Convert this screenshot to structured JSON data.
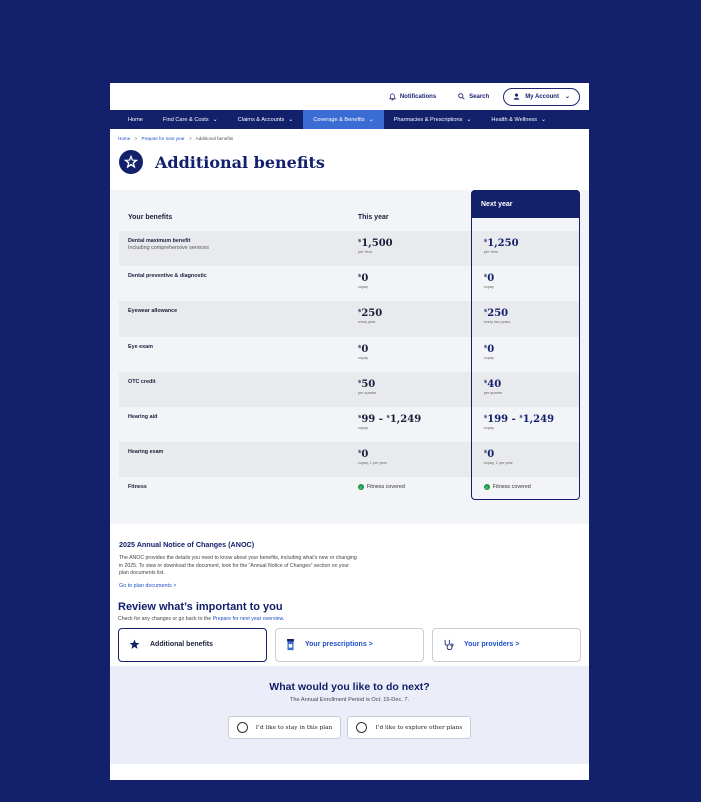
{
  "topbar": {
    "notifications": "Notifications",
    "search": "Search",
    "account": "My Account"
  },
  "nav": [
    {
      "label": "Home",
      "dropdown": false,
      "active": false
    },
    {
      "label": "Find Care & Costs",
      "dropdown": true,
      "active": false
    },
    {
      "label": "Claims & Accounts",
      "dropdown": true,
      "active": false
    },
    {
      "label": "Coverage & Benefits",
      "dropdown": true,
      "active": true
    },
    {
      "label": "Pharmacies & Prescriptions",
      "dropdown": true,
      "active": false
    },
    {
      "label": "Health & Wellness",
      "dropdown": true,
      "active": false
    }
  ],
  "breadcrumb": {
    "home": "Home",
    "prepare": "Prepare for next year",
    "current": "Additional benefits",
    "sep": ">"
  },
  "page_title": "Additional benefits",
  "table": {
    "col1": "Your benefits",
    "col2": "This year",
    "col3": "Next year",
    "rows": [
      {
        "name": "Dental maximum benefit",
        "sub": "Including comprehensive services",
        "this_year": "1,500",
        "this_unit": "per Year",
        "next_year": "1,250",
        "next_unit": "per Year"
      },
      {
        "name": "Dental preventive & diagnostic",
        "sub": "",
        "this_year": "0",
        "this_unit": "copay",
        "next_year": "0",
        "next_unit": "copay"
      },
      {
        "name": "Eyewear allowance",
        "sub": "",
        "this_year": "250",
        "this_unit": "every year",
        "next_year": "250",
        "next_unit": "every two years"
      },
      {
        "name": "Eye exam",
        "sub": "",
        "this_year": "0",
        "this_unit": "copay",
        "next_year": "0",
        "next_unit": "copay"
      },
      {
        "name": "OTC credit",
        "sub": "",
        "this_year": "50",
        "this_unit": "per quarter",
        "next_year": "40",
        "next_unit": "per quarter"
      },
      {
        "name": "Hearing aid",
        "sub": "",
        "this_year": "99 - ",
        "this_year2": "1,249",
        "this_unit": "copay",
        "next_year": "199 - ",
        "next_year2": "1,249",
        "next_unit": "copay"
      },
      {
        "name": "Hearing exam",
        "sub": "",
        "this_year": "0",
        "this_unit": "copay, 1 per year",
        "next_year": "0",
        "next_unit": "copay, 1 per year"
      }
    ],
    "fitness": {
      "name": "Fitness",
      "this_year": "Fitness covered",
      "next_year": "Fitness covered"
    },
    "currency": "$"
  },
  "anoc": {
    "title": "2025 Annual Notice of  Changes (ANOC)",
    "body": "The ANOC provides the details you need to know about your benefits, including what’s new or changing in 2025. To view or download the document, look for the “Annual Notice of Changes” section on your plan documents list.",
    "link": "Go to plan documents >"
  },
  "review": {
    "title": "Review what’s important to you",
    "subtitle": "Check for any changes or go back to the ",
    "subtitle_link": "Prepare for next year overview.",
    "cards": [
      {
        "label": "Additional benefits",
        "icon": "star-icon",
        "selected": true
      },
      {
        "label": "Your prescriptions >",
        "icon": "pill-bottle-icon",
        "selected": false
      },
      {
        "label": "Your providers >",
        "icon": "stethoscope-icon",
        "selected": false
      }
    ]
  },
  "next_steps": {
    "title": "What would you like to do next?",
    "subtitle": "The Annual Enrollment Period is Oct. 15-Dec. 7.",
    "option1": "I’d like to stay in this plan",
    "option2": "I’d like to explore other plans"
  },
  "colors": {
    "navy": "#13206b",
    "active_nav": "#3b6cd4",
    "link": "#1e50c8",
    "success": "#1a9a4a"
  }
}
